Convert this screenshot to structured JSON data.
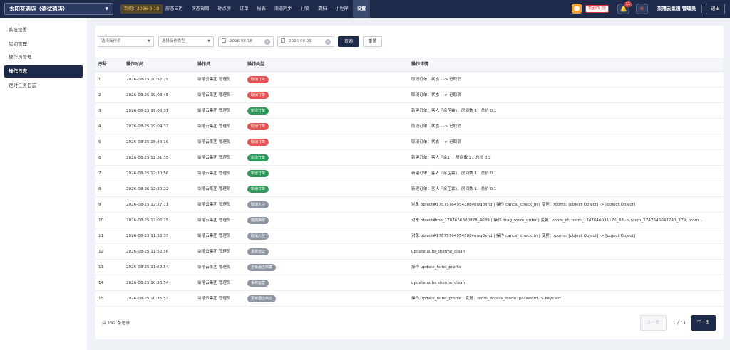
{
  "topbar": {
    "hotel_name": "太阳花酒店（测试酒店）",
    "expire_label": "到期：2026-9-10",
    "nav": [
      "房态日历",
      "房态视图",
      "钟点房",
      "订单",
      "报表",
      "渠道同步",
      "门锁",
      "清扫",
      "小程序",
      "设置"
    ],
    "active_nav": "设置",
    "switch_store_label": "集团切门店",
    "notification_count": "11",
    "user_name": "柒禧云集团 管理员",
    "logout_label": "退出"
  },
  "sidebar": {
    "items": [
      "系统设置",
      "房间管理",
      "操作员管理",
      "操作日志",
      "定时任务日志"
    ],
    "active": "操作日志"
  },
  "filters": {
    "operator_placeholder": "选择操作员",
    "type_placeholder": "选择操作类型",
    "start_date": "2026-08-18",
    "end_date": "2026-08-25",
    "query_label": "查询",
    "reset_label": "重置"
  },
  "table": {
    "headers": [
      "序号",
      "操作时间",
      "操作员",
      "操作类型",
      "操作详情"
    ],
    "rows": [
      {
        "seq": "1",
        "time": "2026-08-25 20:57:29",
        "operator": "柒禧云集团 管理员",
        "type": "取消订单",
        "tag": "red",
        "detail": "取消订单：状态 - -> 已取消"
      },
      {
        "seq": "2",
        "time": "2026-08-25 19:08:45",
        "operator": "柒禧云集团 管理员",
        "type": "取消订单",
        "tag": "red",
        "detail": "取消订单：状态 - -> 已取消"
      },
      {
        "seq": "3",
        "time": "2026-08-25 19:08:31",
        "operator": "柒禧云集团 管理员",
        "type": "新增订单",
        "tag": "green",
        "detail": "新建订单：客人「余芷霖」，房间数 1，总价 0.1"
      },
      {
        "seq": "4",
        "time": "2026-08-25 19:04:33",
        "operator": "柒禧云集团 管理员",
        "type": "取消订单",
        "tag": "red",
        "detail": "取消订单：状态 - -> 已取消"
      },
      {
        "seq": "5",
        "time": "2026-08-25 18:49:16",
        "operator": "柒禧云集团 管理员",
        "type": "取消订单",
        "tag": "red",
        "detail": "取消订单：状态 - -> 已取消"
      },
      {
        "seq": "6",
        "time": "2026-08-25 12:51:35",
        "operator": "柒禧云集团 管理员",
        "type": "新增订单",
        "tag": "green",
        "detail": "新建订单：客人「余2」，房间数 2，总价 0.2"
      },
      {
        "seq": "7",
        "time": "2026-08-25 12:30:56",
        "operator": "柒禧云集团 管理员",
        "type": "新增订单",
        "tag": "green",
        "detail": "新建订单：客人「余芷霖」，房间数 1，总价 0.1"
      },
      {
        "seq": "8",
        "time": "2026-08-25 12:30:22",
        "operator": "柒禧云集团 管理员",
        "type": "新增订单",
        "tag": "green",
        "detail": "新建订单：客人「余芷霖」，房间数 1，总价 0.1"
      },
      {
        "seq": "9",
        "time": "2026-08-25 12:27:11",
        "operator": "柒禧云集团 管理员",
        "type": "取消入住",
        "tag": "gray",
        "detail": "对象 object#17875764954388vewq3xnd | 操作 cancel_check_in | 变更：rooms: [object Object] -> [object Object]"
      },
      {
        "seq": "10",
        "time": "2026-08-25 12:06:15",
        "operator": "柒禧云集团 管理员",
        "type": "拖拽换房",
        "tag": "gray",
        "detail": "对象 object#mo_17876563808​78_4039 | 操作 drag_room_order | 变更：room_id: room_1747646031176_93 -> room_1747646047740_279; room..."
      },
      {
        "seq": "11",
        "time": "2026-08-25 11:53:33",
        "operator": "柒禧云集团 管理员",
        "type": "取消入住",
        "tag": "gray",
        "detail": "对象 object#17875764954388vewq3xnd | 操作 cancel_check_in | 变更：rooms: [object Object] -> [object Object]"
      },
      {
        "seq": "12",
        "time": "2026-08-25 11:52:56",
        "operator": "柒禧云集团 管理员",
        "type": "系统运营",
        "tag": "gray",
        "detail": "update auto_shenhe_clean"
      },
      {
        "seq": "13",
        "time": "2026-08-25 11:52:54",
        "operator": "柒禧云集团 管理员",
        "type": "更新酒店档案",
        "tag": "gray",
        "detail": "操作 update_hotel_profile"
      },
      {
        "seq": "14",
        "time": "2026-08-25 10:36:54",
        "operator": "柒禧云集团 管理员",
        "type": "系统运营",
        "tag": "gray",
        "detail": "update auto_shenhe_clean"
      },
      {
        "seq": "15",
        "time": "2026-08-25 10:36:53",
        "operator": "柒禧云集团 管理员",
        "type": "更新酒店档案",
        "tag": "gray",
        "detail": "操作 update_hotel_profile | 变更：room_access_mode: password -> keycard"
      }
    ]
  },
  "pagination": {
    "total_label": "共 152 条记录",
    "prev_label": "上一页",
    "page_indicator": "1 / 11",
    "next_label": "下一页"
  },
  "colors": {
    "header_bg": "#1e2a4a",
    "tag_red": "#e35353",
    "tag_green": "#2f9a5b",
    "tag_gray": "#8e95a3"
  }
}
